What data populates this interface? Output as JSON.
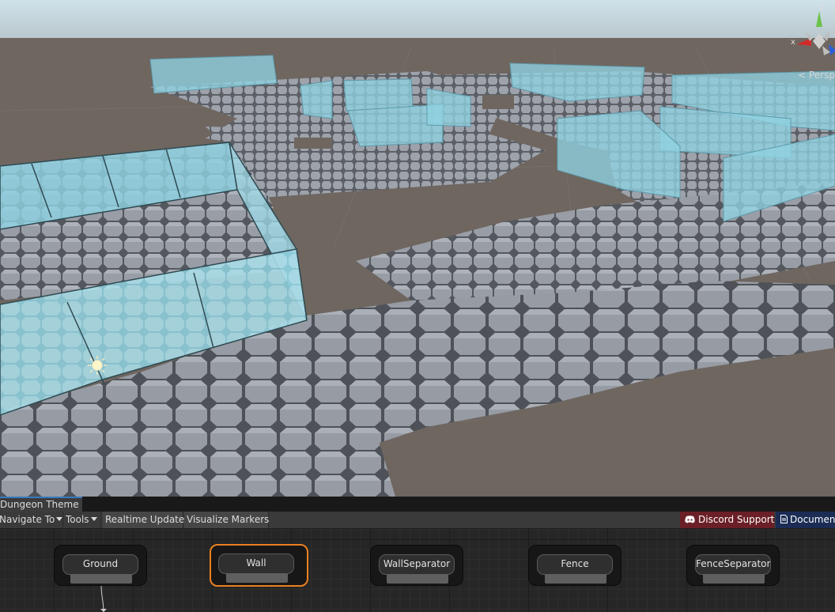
{
  "scene": {
    "gizmo": {
      "x_label": "x",
      "y_label": "y"
    },
    "persp_label": "< Persp"
  },
  "editor": {
    "tab_title": "Dungeon Theme",
    "toolbar": {
      "navigate_to": "Navigate To",
      "tools": "Tools",
      "realtime_update": "Realtime Update",
      "visualize_markers": "Visualize Markers",
      "discord_support": "Discord Support",
      "documentation": "Documentation"
    },
    "nodes": [
      {
        "label": "Ground",
        "selected": false
      },
      {
        "label": "Wall",
        "selected": true
      },
      {
        "label": "WallSeparator",
        "selected": false
      },
      {
        "label": "Fence",
        "selected": false
      },
      {
        "label": "FenceSeparator",
        "selected": false
      }
    ]
  },
  "colors": {
    "selection": "#e9801f",
    "discord": "#6b1f26",
    "documentation": "#1b2c55",
    "tab_accent": "#3a79bb"
  }
}
